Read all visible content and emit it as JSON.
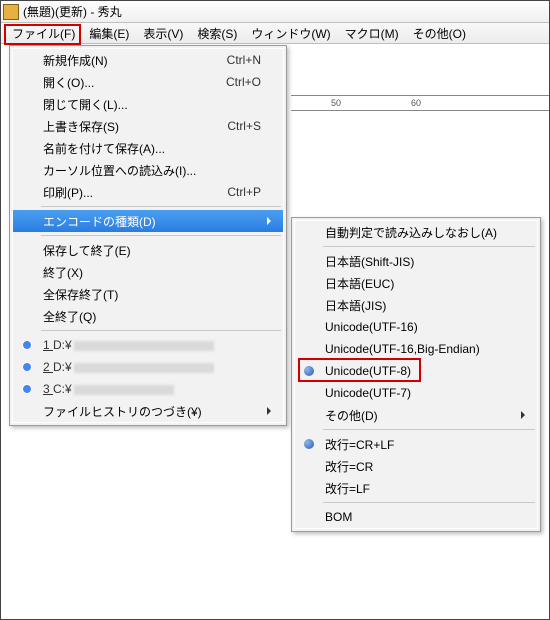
{
  "window": {
    "title": "(無題)(更新) - 秀丸"
  },
  "menubar": [
    "ファイル(F)",
    "編集(E)",
    "表示(V)",
    "検索(S)",
    "ウィンドウ(W)",
    "マクロ(M)",
    "その他(O)"
  ],
  "ruler": {
    "mark50": "50",
    "mark60": "60"
  },
  "fileMenu": {
    "new": {
      "label": "新規作成(N)",
      "shortcut": "Ctrl+N"
    },
    "open": {
      "label": "開く(O)...",
      "shortcut": "Ctrl+O"
    },
    "closeOpen": {
      "label": "閉じて開く(L)..."
    },
    "save": {
      "label": "上書き保存(S)",
      "shortcut": "Ctrl+S"
    },
    "saveAs": {
      "label": "名前を付けて保存(A)..."
    },
    "loadCursor": {
      "label": "カーソル位置への読込み(I)..."
    },
    "print": {
      "label": "印刷(P)...",
      "shortcut": "Ctrl+P"
    },
    "encoding": {
      "label": "エンコードの種類(D)"
    },
    "saveExit": {
      "label": "保存して終了(E)"
    },
    "exit": {
      "label": "終了(X)"
    },
    "saveAllExit": {
      "label": "全保存終了(T)"
    },
    "exitAll": {
      "label": "全終了(Q)"
    },
    "mru1": {
      "prefix": "1 ",
      "drive": "D:¥"
    },
    "mru2": {
      "prefix": "2 ",
      "drive": "D:¥"
    },
    "mru3": {
      "prefix": "3 ",
      "drive": "C:¥"
    },
    "history": {
      "label": "ファイルヒストリのつづき(¥)"
    }
  },
  "encMenu": {
    "auto": {
      "label": "自動判定で読み込みしなおし(A)"
    },
    "sjis": {
      "label": "日本語(Shift-JIS)"
    },
    "euc": {
      "label": "日本語(EUC)"
    },
    "jis": {
      "label": "日本語(JIS)"
    },
    "utf16": {
      "label": "Unicode(UTF-16)"
    },
    "utf16be": {
      "label": "Unicode(UTF-16,Big-Endian)"
    },
    "utf8": {
      "label": "Unicode(UTF-8)"
    },
    "utf7": {
      "label": "Unicode(UTF-7)"
    },
    "other": {
      "label": "その他(D)"
    },
    "crlf": {
      "label": "改行=CR+LF"
    },
    "cr": {
      "label": "改行=CR"
    },
    "lf": {
      "label": "改行=LF"
    },
    "bom": {
      "label": "BOM"
    }
  }
}
